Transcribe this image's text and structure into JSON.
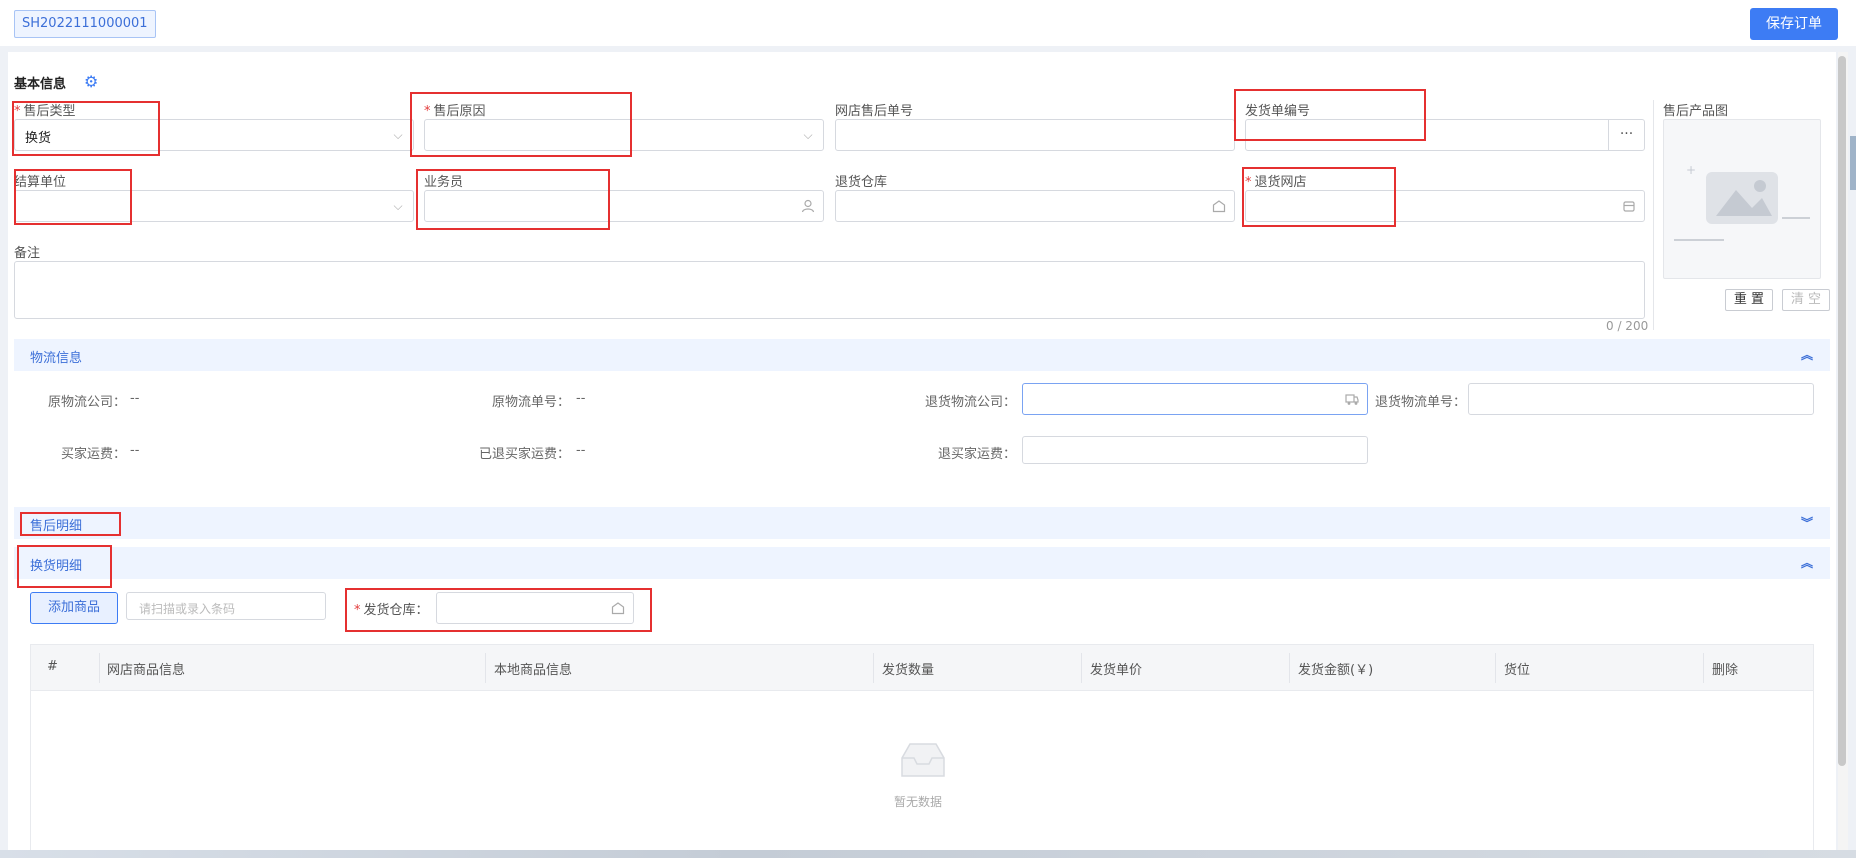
{
  "header": {
    "order_no": "SH2022111000001",
    "save_label": "保存订单"
  },
  "basic": {
    "title": "基本信息",
    "aftersale_type": {
      "label": "售后类型",
      "value": "换货"
    },
    "aftersale_reason": {
      "label": "售后原因",
      "value": ""
    },
    "shop_order_no": {
      "label": "网店售后单号",
      "value": ""
    },
    "ship_no": {
      "label": "发货单编号",
      "value": "",
      "more": "···"
    },
    "settle_unit": {
      "label": "结算单位",
      "value": ""
    },
    "salesman": {
      "label": "业务员",
      "value": ""
    },
    "return_wh": {
      "label": "退货仓库",
      "value": ""
    },
    "return_shop": {
      "label": "退货网店",
      "value": ""
    },
    "remark": {
      "label": "备注",
      "counter": "0 / 200"
    },
    "product_image": {
      "label": "售后产品图",
      "reset": "重 置",
      "clear": "清 空"
    }
  },
  "logistics": {
    "title": "物流信息",
    "orig_company_label": "原物流公司：",
    "orig_company_value": "--",
    "orig_no_label": "原物流单号：",
    "orig_no_value": "--",
    "ret_company_label": "退货物流公司：",
    "ret_no_label": "退货物流单号：",
    "buyer_fee_label": "买家运费：",
    "buyer_fee_value": "--",
    "refunded_fee_label": "已退买家运费：",
    "refunded_fee_value": "--",
    "refund_fee_label": "退买家运费："
  },
  "aftersale_detail": {
    "title": "售后明细"
  },
  "exchange": {
    "title": "换货明细",
    "add_label": "添加商品",
    "scan_placeholder": "请扫描或录入条码",
    "ship_wh_label": "发货仓库：",
    "columns": [
      "#",
      "网店商品信息",
      "本地商品信息",
      "发货数量",
      "发货单价",
      "发货金额(￥)",
      "货位",
      "删除"
    ],
    "empty": "暂无数据"
  },
  "colors": {
    "primary": "#3d7cf4",
    "highlight": "#e53030"
  }
}
